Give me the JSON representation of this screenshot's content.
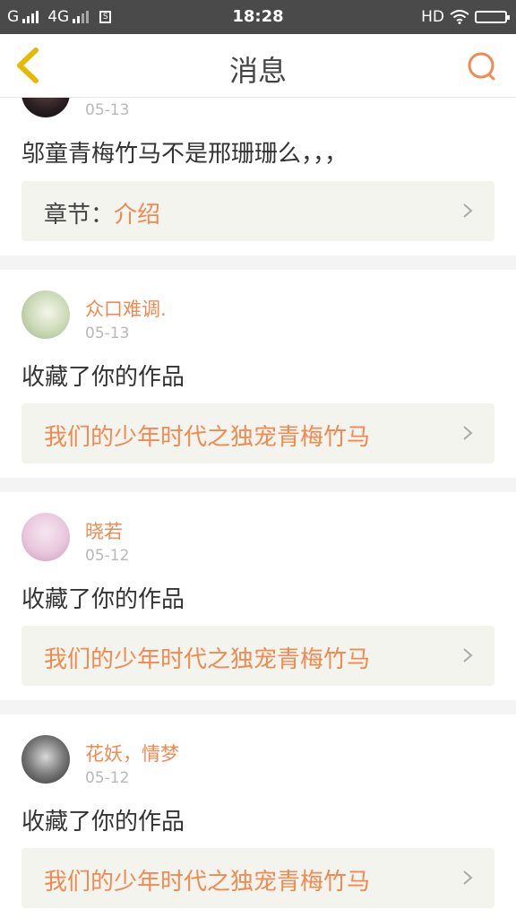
{
  "status_bar": {
    "carrier": "G",
    "network": "4G",
    "time": "18:28",
    "hd": "HD"
  },
  "header": {
    "title": "消息",
    "back_icon": "back-chevron-icon",
    "search_icon": "search-icon"
  },
  "colors": {
    "accent": "#f08a50",
    "back_icon": "#e6b800",
    "link_bg": "#f3f4ee"
  },
  "messages": [
    {
      "user": "",
      "date": "05-13",
      "text": "邬童青梅竹马不是邢珊珊么，，，",
      "link_label": "章节：",
      "link_value": "介绍"
    },
    {
      "user": "众口难调.",
      "date": "05-13",
      "text": "收藏了你的作品",
      "link_label": "",
      "link_value": "我们的少年时代之独宠青梅竹马"
    },
    {
      "user": "晓若",
      "date": "05-12",
      "text": "收藏了你的作品",
      "link_label": "",
      "link_value": "我们的少年时代之独宠青梅竹马"
    },
    {
      "user": "花妖，情梦",
      "date": "05-12",
      "text": "收藏了你的作品",
      "link_label": "",
      "link_value": "我们的少年时代之独宠青梅竹马"
    }
  ]
}
